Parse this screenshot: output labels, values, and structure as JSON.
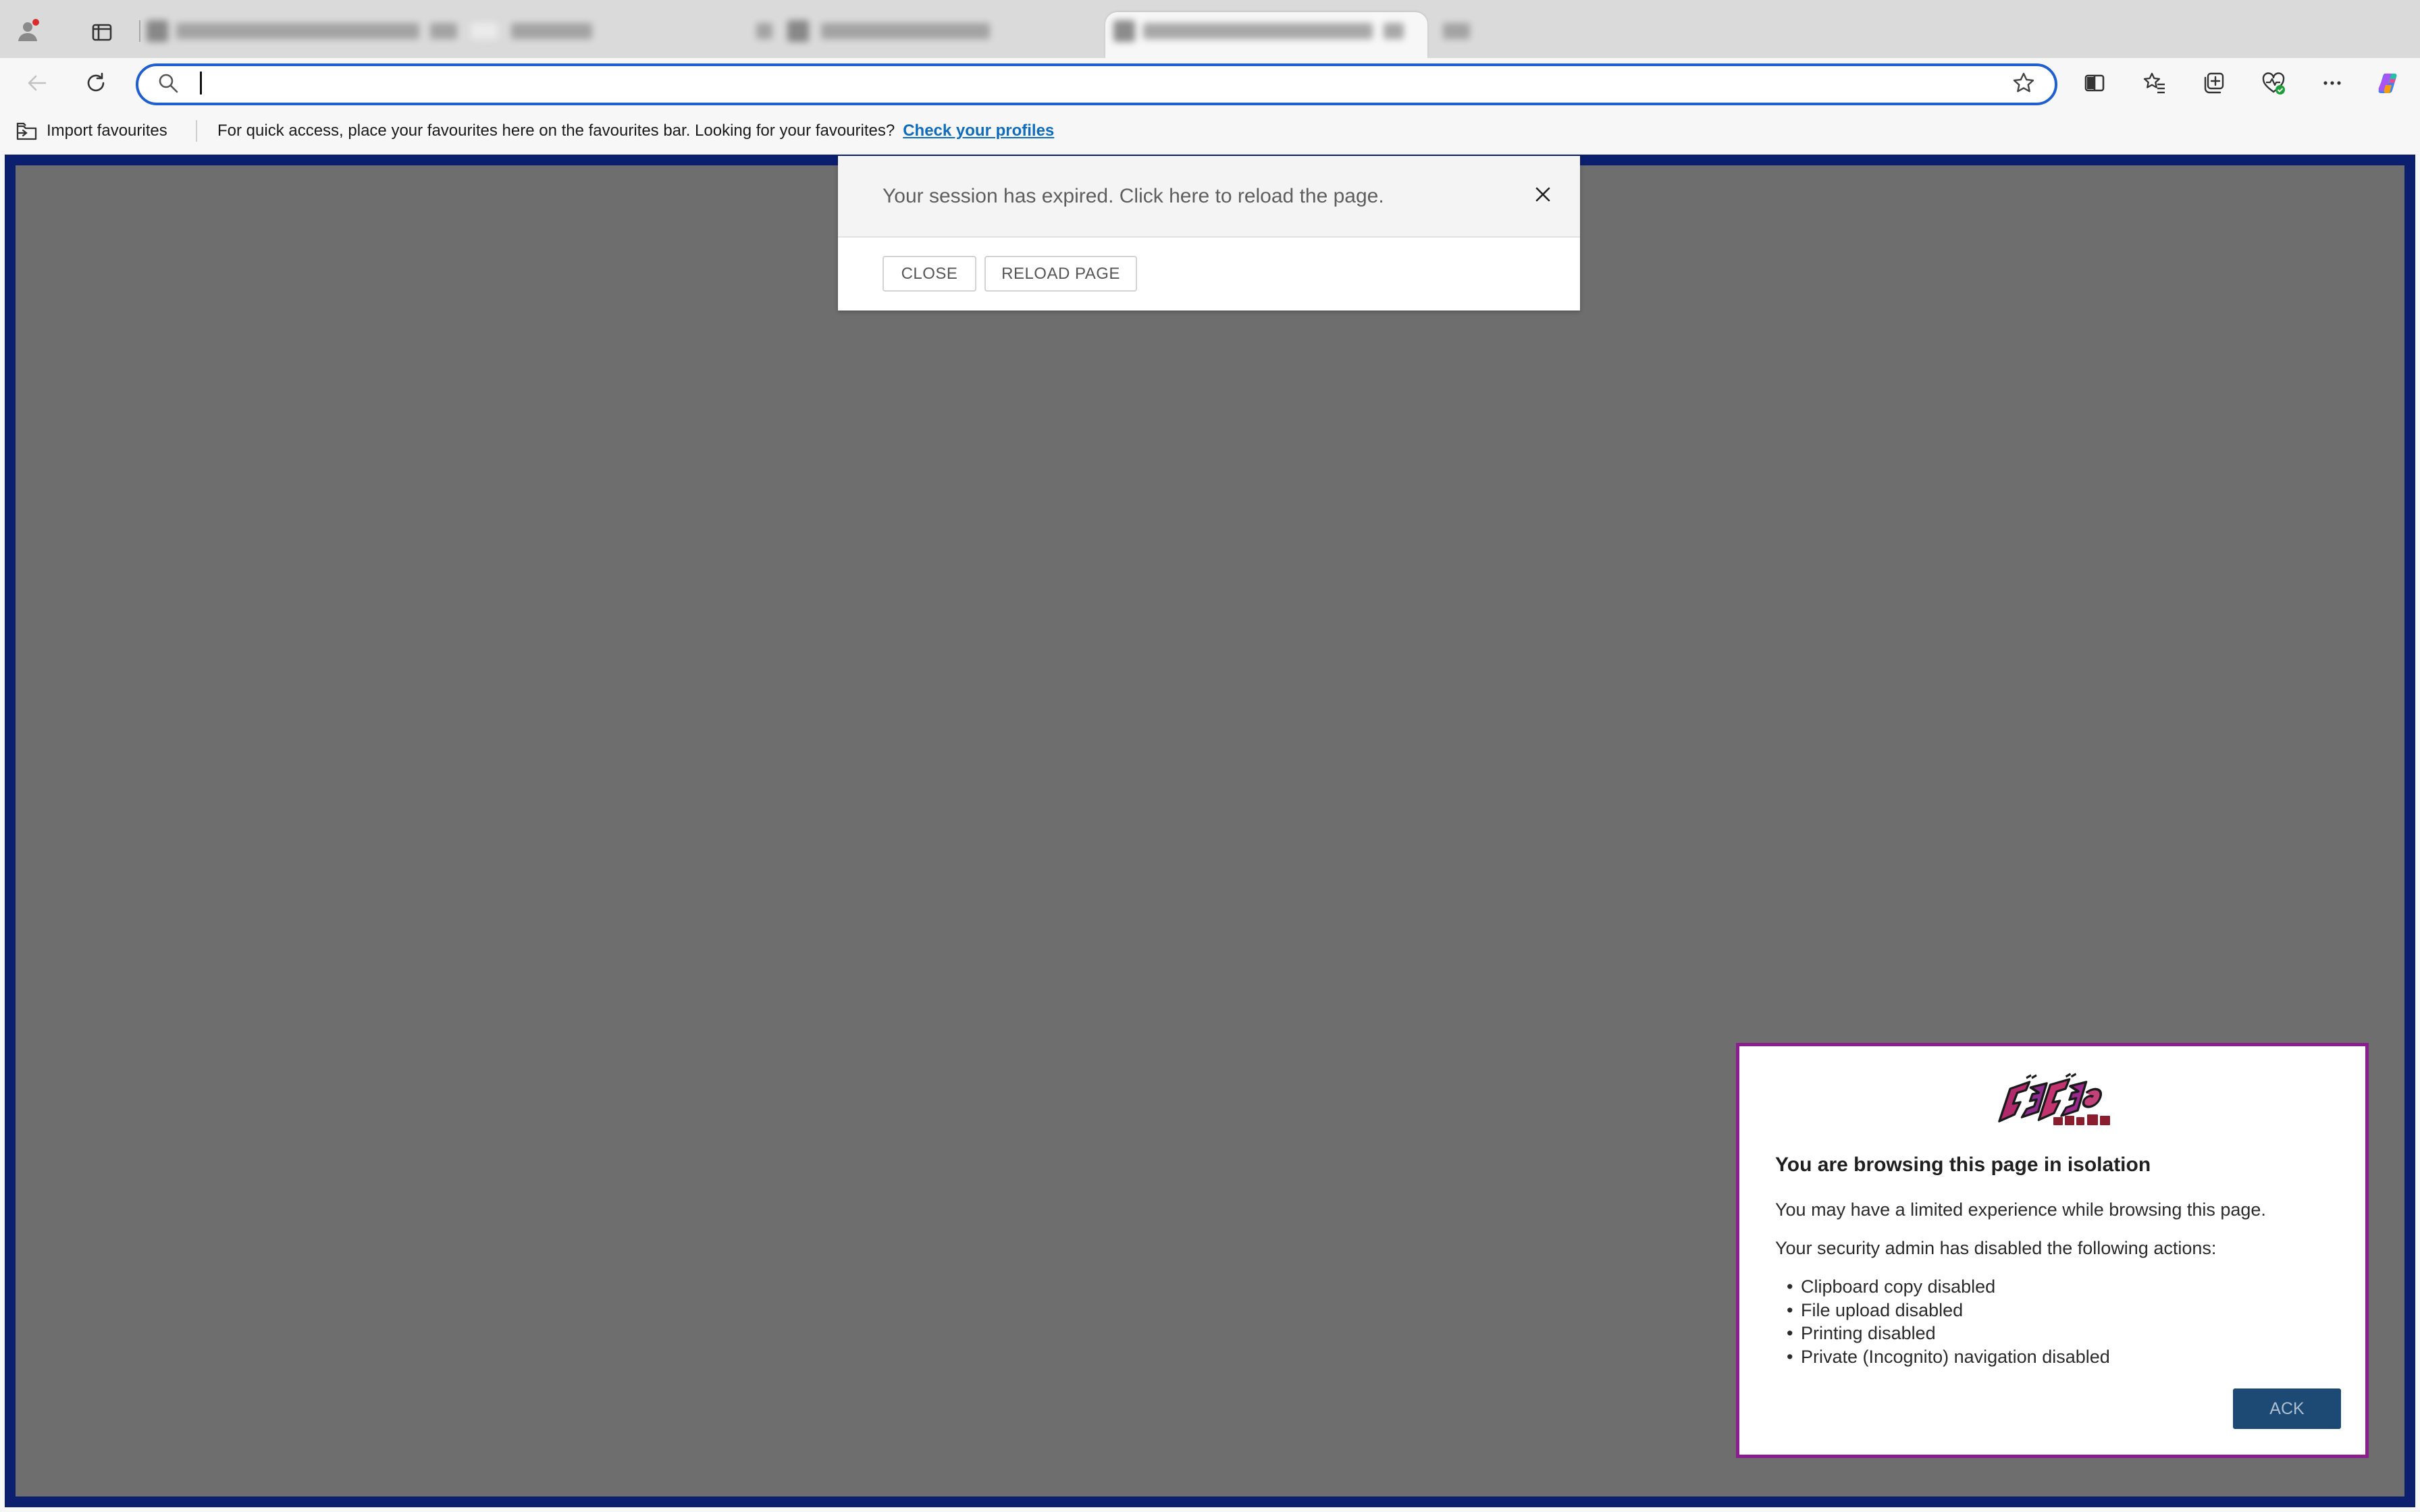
{
  "browser": {
    "tabs": [
      {
        "active": false
      },
      {
        "active": false
      },
      {
        "active": true
      },
      {
        "active": false
      }
    ],
    "address_bar": {
      "value": "",
      "placeholder": ""
    },
    "toolbar_icons": [
      "back-icon",
      "refresh-icon",
      "search-icon",
      "star-icon",
      "split-screen-icon",
      "favorites-icon",
      "collections-icon",
      "browser-essentials-icon",
      "more-icon",
      "copilot-icon"
    ],
    "tabstrip_icons": [
      "profile-icon",
      "tab-actions-icon"
    ],
    "favourites_bar": {
      "import_label": "Import favourites",
      "message": "For quick access, place your favourites here on the favourites bar. Looking for your favourites?",
      "link": "Check your profiles"
    }
  },
  "session_modal": {
    "message": "Your session has expired. Click here to reload the page.",
    "close_label": "CLOSE",
    "reload_label": "RELOAD PAGE"
  },
  "isolation_panel": {
    "logo_icon": "jojo-logo",
    "title": "You are browsing this page in isolation",
    "intro": "You may have a limited experience while browsing this page.",
    "restrictions_heading": "Your security admin has disabled the following actions:",
    "restrictions": [
      "Clipboard copy disabled",
      "File upload disabled",
      "Printing disabled",
      "Private (Incognito) navigation disabled"
    ],
    "ack_label": "ACK"
  },
  "colors": {
    "frame_border": "#0c1f6f",
    "page_overlay": "#6e6e6e",
    "panel_border": "#8a1e8f",
    "ack_button": "#1c4a74",
    "link": "#0f6cbd",
    "address_focus": "#1f5fcf",
    "profile_badge": "#d92b2b"
  }
}
